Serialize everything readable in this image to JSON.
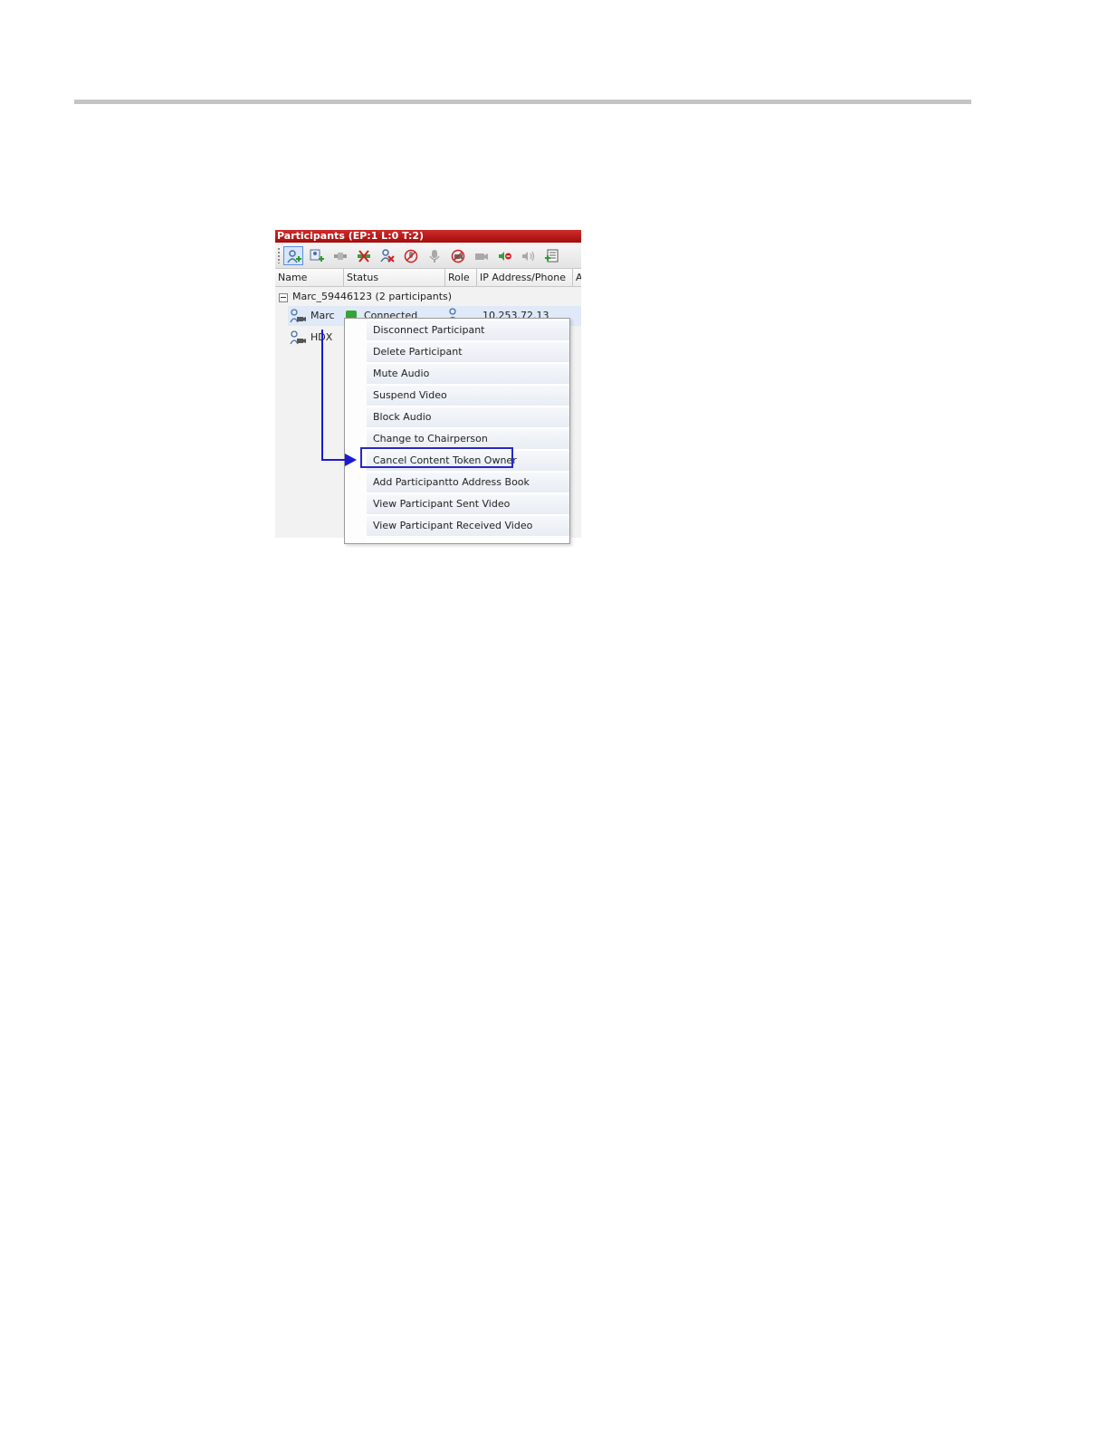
{
  "window": {
    "title": "Participants (EP:1 L:0 T:2)"
  },
  "toolbar": {
    "icons": [
      "add-participant-icon",
      "add-from-address-book-icon",
      "connect-icon",
      "disconnect-icon",
      "delete-participant-icon",
      "mute-audio-icon",
      "microphone-icon",
      "suspend-video-icon",
      "camera-icon",
      "block-audio-icon",
      "speaker-icon",
      "view-properties-icon"
    ]
  },
  "columns": [
    "Name",
    "Status",
    "Role",
    "IP Address/Phone",
    "A"
  ],
  "conference": {
    "label": "Marc_59446123 (2  participants)"
  },
  "participants": [
    {
      "name": "Marc",
      "status": "Connected",
      "ip": "10.253.72.13"
    },
    {
      "name": "HDX",
      "status": "",
      "ip": ""
    }
  ],
  "context_menu": {
    "items": [
      "Disconnect Participant",
      "Delete Participant",
      "Mute Audio",
      "Suspend Video",
      "Block Audio",
      "Change to Chairperson",
      "Cancel Content Token Owner",
      "Add Participantto Address Book",
      "View Participant Sent Video",
      "View Participant Received Video"
    ],
    "highlighted_index": 6
  },
  "colors": {
    "title_bar": "#b81616",
    "highlight_border": "#2727c9",
    "arrow": "#1a1ad6"
  }
}
